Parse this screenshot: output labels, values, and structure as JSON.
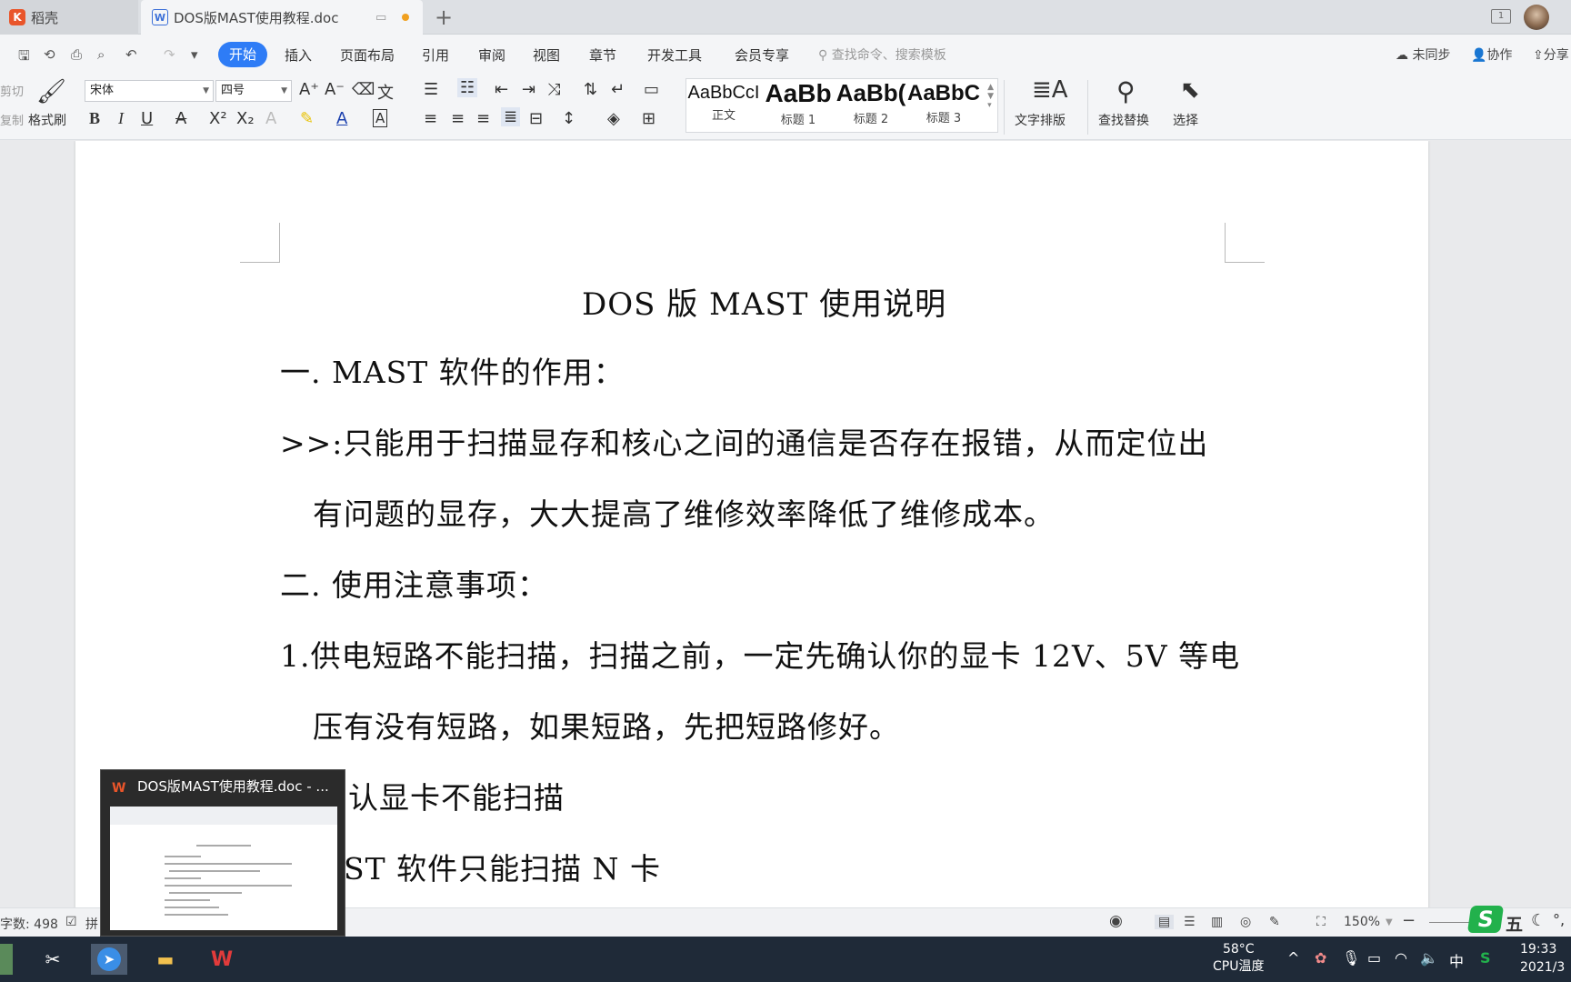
{
  "tabs": {
    "home": "稻壳",
    "doc": "DOS版MAST使用教程.doc",
    "window_count": "1"
  },
  "menu": {
    "items": [
      "开始",
      "插入",
      "页面布局",
      "引用",
      "审阅",
      "视图",
      "章节",
      "开发工具",
      "会员专享"
    ],
    "search_placeholder": "查找命令、搜索模板",
    "unsynced": "未同步",
    "collab": "协作",
    "share": "分享"
  },
  "ribbon": {
    "cut": "剪切",
    "copy": "复制",
    "format_painter": "格式刷",
    "font_name": "宋体",
    "font_size": "四号",
    "styles": [
      {
        "preview": "AaBbCcI",
        "name": "正文"
      },
      {
        "preview": "AaBb",
        "name": "标题 1"
      },
      {
        "preview": "AaBb(",
        "name": "标题 2"
      },
      {
        "preview": "AaBbC",
        "name": "标题 3"
      }
    ],
    "text_layout": "文字排版",
    "find_replace": "查找替换",
    "select": "选择"
  },
  "document": {
    "title": "DOS 版 MAST 使用说明",
    "lines": [
      "一. MAST 软件的作用：",
      ">>:只能用于扫描显存和核心之间的通信是否存在报错，从而定位出",
      "有问题的显存，大大提高了维修效率降低了维修成本。",
      "二. 使用注意事项：",
      "1.供电短路不能扫描，扫描之前，一定先确认你的显卡 12V、5V 等电",
      "压有没有短路，如果短路，先把短路修好。",
      "认显卡不能扫描",
      "ST 软件只能扫描 N 卡"
    ]
  },
  "statusbar": {
    "word_count": "字数: 498",
    "spell": "拼",
    "zoom": "150%"
  },
  "preview": {
    "title": "DOS版MAST使用教程.doc - ..."
  },
  "taskbar": {
    "temp": "58°C",
    "temp_label": "CPU温度",
    "ime": "中",
    "time": "19:33",
    "date": "2021/3"
  }
}
